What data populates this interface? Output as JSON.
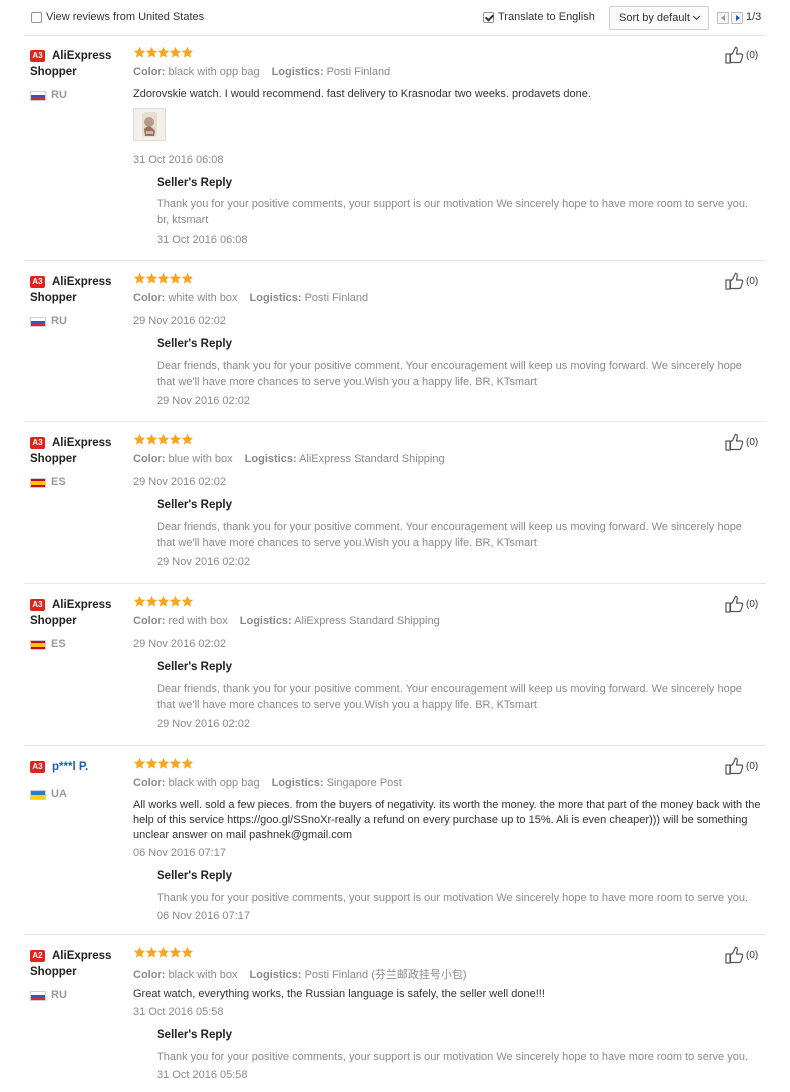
{
  "toolbar": {
    "filter_label": "View reviews from United States",
    "filter_checked": false,
    "translate_label": "Translate to English",
    "translate_checked": true,
    "sort_label": "Sort by default",
    "page_indicator": "1/3"
  },
  "colors": {
    "star": "#f5a623",
    "badge": "#e0241b",
    "link": "#1a5fb4",
    "muted": "#8a8a8a"
  },
  "labels": {
    "color": "Color:",
    "logistics": "Logistics:",
    "seller_reply": "Seller's Reply"
  },
  "reviews": [
    {
      "badge": "A3",
      "name": "AliExpress Shopper",
      "name_is_link": false,
      "country": "RU",
      "flag": "ru",
      "stars": 5,
      "color": "black with opp bag",
      "logistics": "Posti Finland",
      "feedback": "Zdorovskie watch. I would recommend. fast delivery to Krasnodar two weeks. prodavets done.",
      "has_photo": true,
      "date": "31 Oct 2016 06:08",
      "reply": "Thank you for your positive comments, your support is our motivation We sincerely hope to have more room to serve you. br, ktsmart",
      "reply_date": "31 Oct 2016 06:08",
      "useful": "(0)"
    },
    {
      "badge": "A3",
      "name": "AliExpress Shopper",
      "name_is_link": false,
      "country": "RU",
      "flag": "ru",
      "stars": 5,
      "color": "white with box",
      "logistics": "Posti Finland",
      "feedback": "",
      "has_photo": false,
      "date": "29 Nov 2016 02:02",
      "reply": "Dear friends, thank you for your positive comment. Your encouragement will keep us moving forward. We sincerely hope that we'll have more chances to serve you.Wish you a happy life. BR, KTsmart",
      "reply_date": "29 Nov 2016 02:02",
      "useful": "(0)"
    },
    {
      "badge": "A3",
      "name": "AliExpress Shopper",
      "name_is_link": false,
      "country": "ES",
      "flag": "es",
      "stars": 5,
      "color": "blue with box",
      "logistics": "AliExpress Standard Shipping",
      "feedback": "",
      "has_photo": false,
      "date": "29 Nov 2016 02:02",
      "reply": "Dear friends, thank you for your positive comment. Your encouragement will keep us moving forward. We sincerely hope that we'll have more chances to serve you.Wish you a happy life. BR, KTsmart",
      "reply_date": "29 Nov 2016 02:02",
      "useful": "(0)"
    },
    {
      "badge": "A3",
      "name": "AliExpress Shopper",
      "name_is_link": false,
      "country": "ES",
      "flag": "es",
      "stars": 5,
      "color": "red with box",
      "logistics": "AliExpress Standard Shipping",
      "feedback": "",
      "has_photo": false,
      "date": "29 Nov 2016 02:02",
      "reply": "Dear friends, thank you for your positive comment. Your encouragement will keep us moving forward. We sincerely hope that we'll have more chances to serve you.Wish you a happy life. BR, KTsmart",
      "reply_date": "29 Nov 2016 02:02",
      "useful": "(0)"
    },
    {
      "badge": "A3",
      "name": "p***l P.",
      "name_is_link": true,
      "country": "UA",
      "flag": "ua",
      "stars": 5,
      "color": "black with opp bag",
      "logistics": "Singapore Post",
      "feedback": "All works well. sold a few pieces. from the buyers of negativity. its worth the money. the more that part of the money back with the help of this service https://goo.gl/SSnoXr-really a refund on every purchase up to 15%. Ali is even cheaper))) will be something unclear answer on mail pashnek@gmail.com",
      "has_photo": false,
      "date": "06 Nov 2016 07:17",
      "reply": "Thank you for your positive comments, your support is our motivation We sincerely hope to have more room to serve you.",
      "reply_date": "06 Nov 2016 07:17",
      "useful": "(0)"
    },
    {
      "badge": "A2",
      "name": "AliExpress Shopper",
      "name_is_link": false,
      "country": "RU",
      "flag": "ru",
      "stars": 5,
      "color": "black with box",
      "logistics": "Posti Finland (芬兰邮政挂号小包)",
      "feedback": "Great watch, everything works, the Russian language is safely, the seller well done!!!",
      "has_photo": false,
      "date": "31 Oct 2016 05:58",
      "reply": "Thank you for your positive comments, your support is our motivation We sincerely hope to have more room to serve you.",
      "reply_date": "31 Oct 2016 05:58",
      "useful": "(0)"
    }
  ]
}
